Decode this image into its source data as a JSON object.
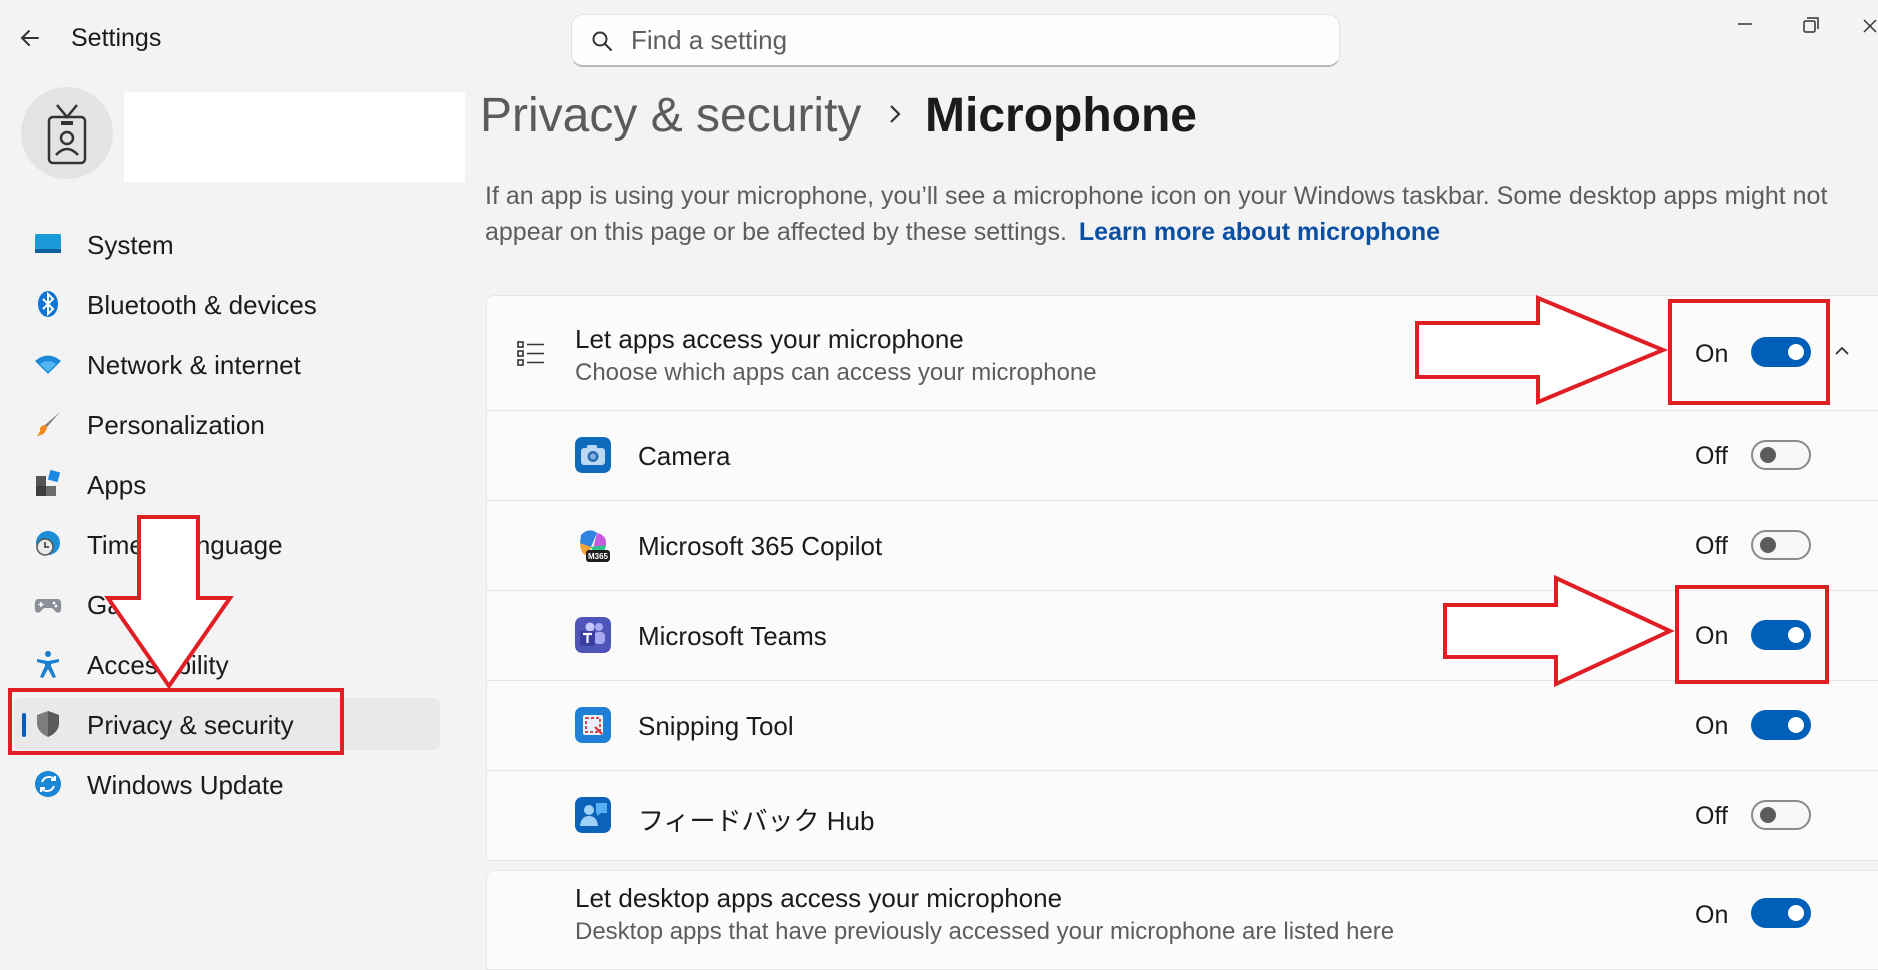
{
  "window": {
    "title": "Settings",
    "search_placeholder": "Find a setting"
  },
  "sidebar": {
    "items": [
      {
        "label": "System",
        "icon": "system-icon"
      },
      {
        "label": "Bluetooth & devices",
        "icon": "bluetooth-icon"
      },
      {
        "label": "Network & internet",
        "icon": "wifi-icon"
      },
      {
        "label": "Personalization",
        "icon": "brush-icon"
      },
      {
        "label": "Apps",
        "icon": "apps-icon"
      },
      {
        "label": "Time & language",
        "icon": "globe-clock-icon"
      },
      {
        "label": "Gaming",
        "icon": "gamepad-icon"
      },
      {
        "label": "Accessibility",
        "icon": "accessibility-icon"
      },
      {
        "label": "Privacy & security",
        "icon": "shield-icon",
        "selected": true
      },
      {
        "label": "Windows Update",
        "icon": "update-icon"
      }
    ]
  },
  "header": {
    "parent": "Privacy & security",
    "current": "Microphone",
    "description": "If an app is using your microphone, you’ll see a microphone icon on your Windows taskbar. Some desktop apps might not appear on this page or be affected by these settings.",
    "learn_more": "Learn more about microphone"
  },
  "main_setting": {
    "title": "Let apps access your microphone",
    "subtitle": "Choose which apps can access your microphone",
    "state": "On",
    "on": true
  },
  "apps": [
    {
      "name": "Camera",
      "state": "Off",
      "on": false,
      "icon": "camera-app-icon",
      "color": "#0f6cbd"
    },
    {
      "name": "Microsoft 365 Copilot",
      "state": "Off",
      "on": false,
      "icon": "m365-copilot-icon",
      "badge": "M365"
    },
    {
      "name": "Microsoft Teams",
      "state": "On",
      "on": true,
      "icon": "teams-icon",
      "color": "#5b5fc7"
    },
    {
      "name": "Snipping Tool",
      "state": "On",
      "on": true,
      "icon": "snipping-tool-icon",
      "color": "#1f80d6"
    },
    {
      "name": "フィードバック Hub",
      "state": "Off",
      "on": false,
      "icon": "feedback-hub-icon",
      "color": "#0a63b8"
    }
  ],
  "desktop_setting": {
    "title": "Let desktop apps access your microphone",
    "subtitle": "Desktop apps that have previously accessed your microphone are listed here",
    "state": "On",
    "on": true
  },
  "colors": {
    "accent": "#005fb8",
    "annotation": "#e01e24",
    "link": "#0b4fa3"
  }
}
